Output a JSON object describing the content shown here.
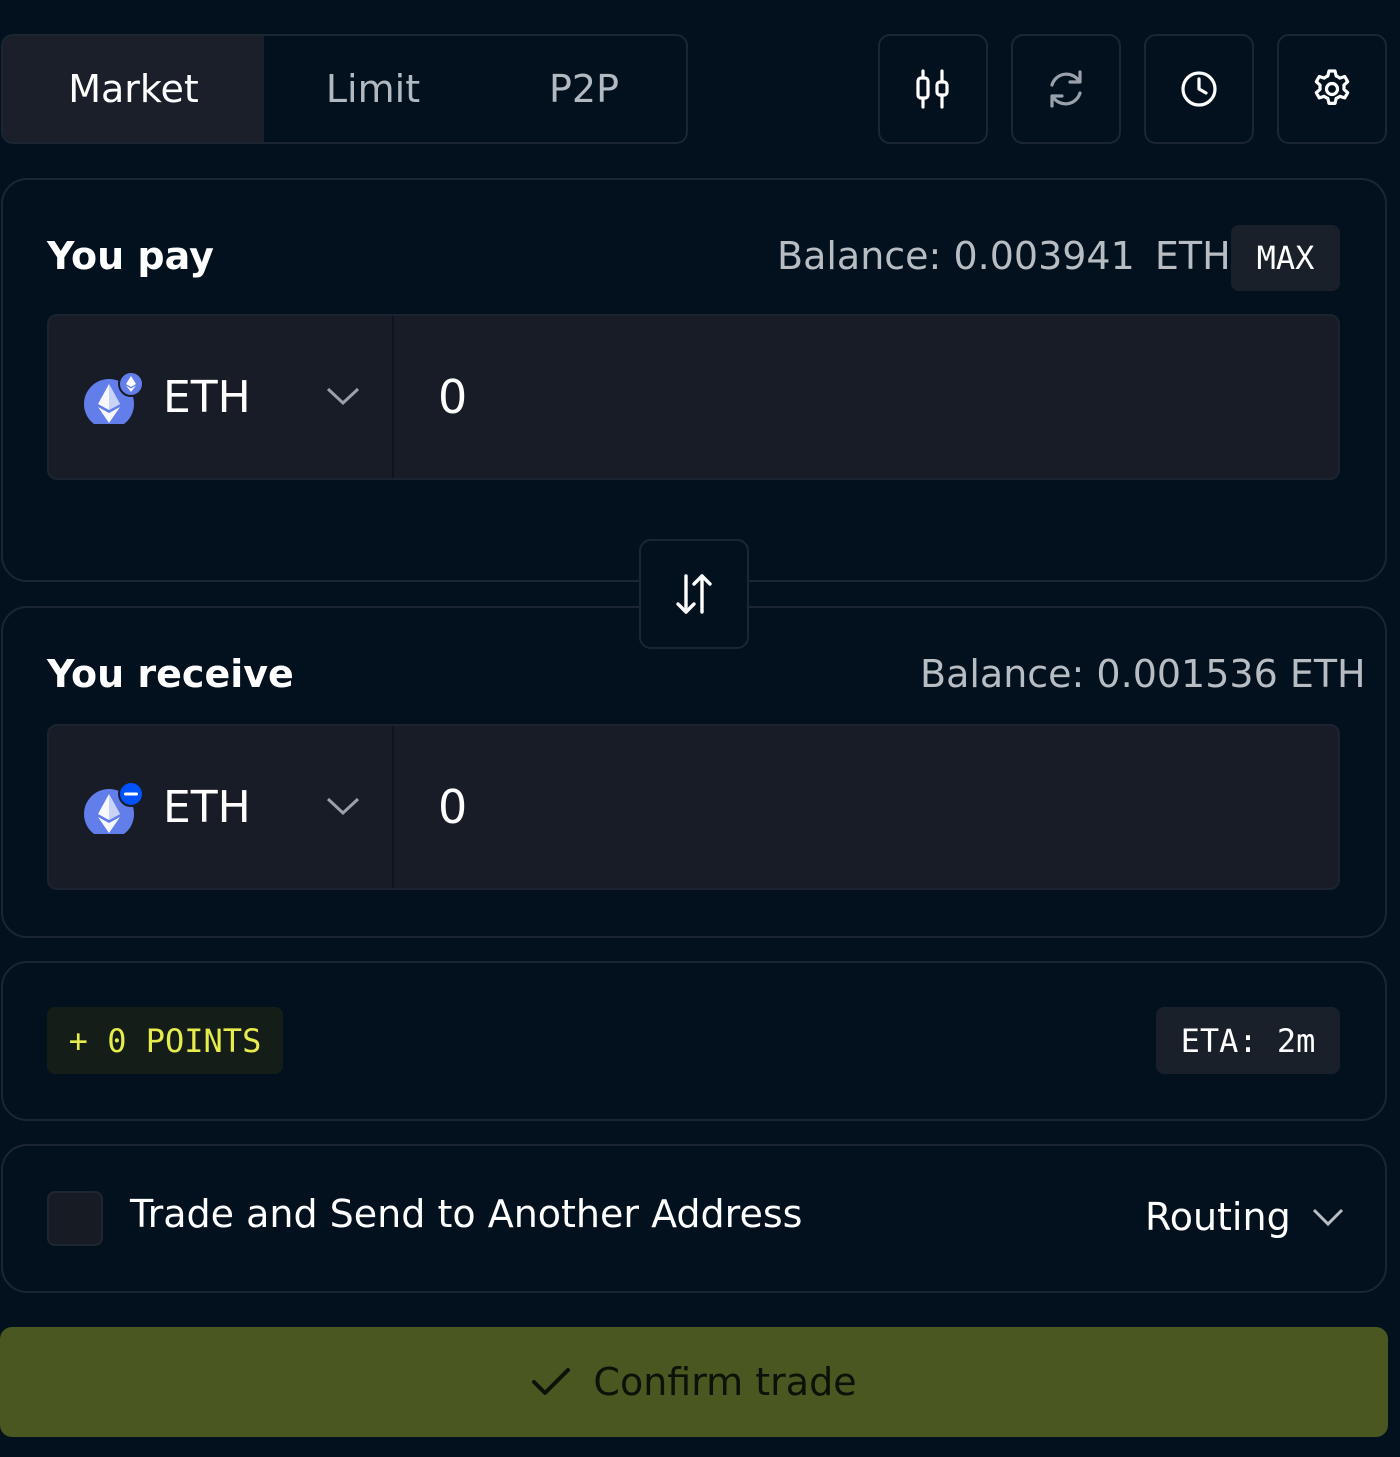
{
  "tabs": [
    {
      "label": "Market",
      "active": true
    },
    {
      "label": "Limit",
      "active": false
    },
    {
      "label": "P2P",
      "active": false
    }
  ],
  "toolbar_icons": [
    "candlestick-chart-icon",
    "refresh-icon",
    "history-clock-icon",
    "settings-gear-icon"
  ],
  "pay": {
    "label": "You pay",
    "balance_label": "Balance:",
    "balance_value": "0.003941",
    "balance_unit": "ETH",
    "max_label": "MAX",
    "token": "ETH",
    "amount": "0"
  },
  "receive": {
    "label": "You receive",
    "balance_text": "Balance: 0.001536 ETH",
    "token": "ETH",
    "amount": "0"
  },
  "info": {
    "points": "+ 0 POINTS",
    "eta": "ETA: 2m"
  },
  "options": {
    "send_label": "Trade and Send to Another Address",
    "send_checked": false,
    "routing_label": "Routing"
  },
  "confirm": {
    "label": "Confirm trade"
  },
  "colors": {
    "background": "#02111d",
    "panel_border": "#1c2632",
    "field_bg": "#181c27",
    "accent_green": "#4b5720",
    "points_yellow": "#e5ec4b",
    "eth_purple": "#627eea"
  }
}
